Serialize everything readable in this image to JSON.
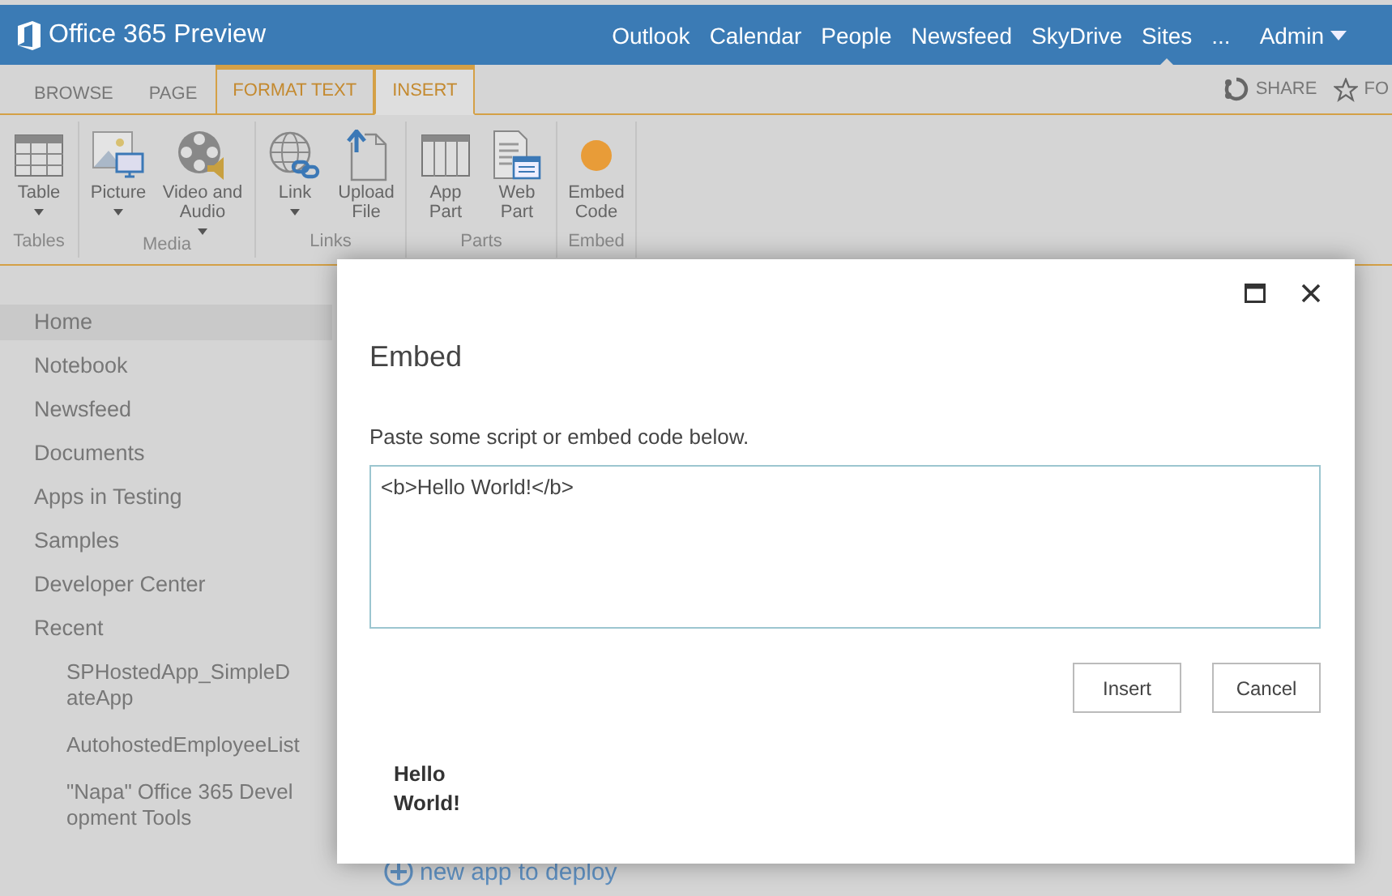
{
  "suite_bar": {
    "title": "Office 365 Preview",
    "nav": [
      {
        "label": "Outlook",
        "selected": false
      },
      {
        "label": "Calendar",
        "selected": false
      },
      {
        "label": "People",
        "selected": false
      },
      {
        "label": "Newsfeed",
        "selected": false
      },
      {
        "label": "SkyDrive",
        "selected": false
      },
      {
        "label": "Sites",
        "selected": true
      },
      {
        "label": "...",
        "selected": false
      }
    ],
    "user": "Admin"
  },
  "ribbon_tabs": [
    {
      "label": "BROWSE",
      "contextual": false,
      "selected": false
    },
    {
      "label": "PAGE",
      "contextual": false,
      "selected": false
    },
    {
      "label": "FORMAT TEXT",
      "contextual": true,
      "selected": false
    },
    {
      "label": "INSERT",
      "contextual": true,
      "selected": true
    }
  ],
  "ribbon_actions": [
    {
      "kind": "share",
      "label": "SHARE"
    },
    {
      "kind": "follow",
      "label": "FO"
    }
  ],
  "ribbon_groups": [
    {
      "label": "Tables",
      "commands": [
        {
          "kind": "table",
          "label": "Table",
          "dropdown": true
        }
      ]
    },
    {
      "label": "Media",
      "commands": [
        {
          "kind": "picture",
          "label": "Picture",
          "dropdown": true
        },
        {
          "kind": "video",
          "label": "Video and Audio",
          "dropdown": true
        }
      ]
    },
    {
      "label": "Links",
      "commands": [
        {
          "kind": "link",
          "label": "Link",
          "dropdown": true
        },
        {
          "kind": "upload",
          "label": "Upload File",
          "dropdown": false
        }
      ]
    },
    {
      "label": "Parts",
      "commands": [
        {
          "kind": "app_part",
          "label": "App Part",
          "dropdown": false
        },
        {
          "kind": "web_part",
          "label": "Web Part",
          "dropdown": false
        }
      ]
    },
    {
      "label": "Embed",
      "commands": [
        {
          "kind": "embed",
          "label": "Embed Code",
          "dropdown": false
        }
      ]
    }
  ],
  "sidebar": {
    "items": [
      {
        "label": "Home",
        "selected": true
      },
      {
        "label": "Notebook",
        "selected": false
      },
      {
        "label": "Newsfeed",
        "selected": false
      },
      {
        "label": "Documents",
        "selected": false
      },
      {
        "label": "Apps in Testing",
        "selected": false
      },
      {
        "label": "Samples",
        "selected": false
      },
      {
        "label": "Developer Center",
        "selected": false
      },
      {
        "label": "Recent",
        "selected": false,
        "children": [
          {
            "label": "SPHostedApp_SimpleDateApp",
            "selected": false
          },
          {
            "label": "AutohostedEmployeeList",
            "selected": false
          },
          {
            "label": "\"Napa\" Office 365 Development Tools",
            "selected": false
          }
        ]
      }
    ]
  },
  "main": {
    "new_app_link": "new app to deploy"
  },
  "dialog": {
    "title": "Embed",
    "prompt": "Paste some script or embed code below.",
    "code": "<b>Hello World!</b>",
    "buttons": [
      "Insert",
      "Cancel"
    ],
    "preview": "Hello World!"
  }
}
